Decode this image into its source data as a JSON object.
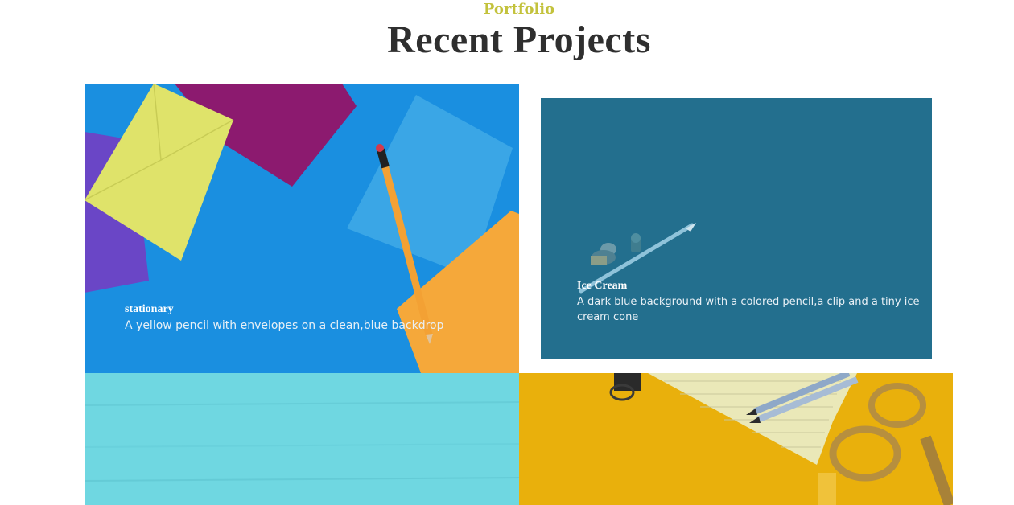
{
  "section": {
    "eyebrow": "Portfolio",
    "title": "Recent Projects"
  },
  "projects": [
    {
      "title": "stationary",
      "description": "A yellow pencil with envelopes on a clean,blue backdrop",
      "background_color": "#1a8fe0"
    },
    {
      "title": "Ice Cream",
      "description": "A dark blue background with a colored pencil,a clip and a tiny ice cream cone",
      "background_color": "#226e8d"
    },
    {
      "background_color": "#6fd8e2"
    },
    {
      "background_color": "#e9b00c"
    }
  ],
  "colors": {
    "eyebrow": "#c3c23c",
    "title": "#2f2f2f"
  }
}
